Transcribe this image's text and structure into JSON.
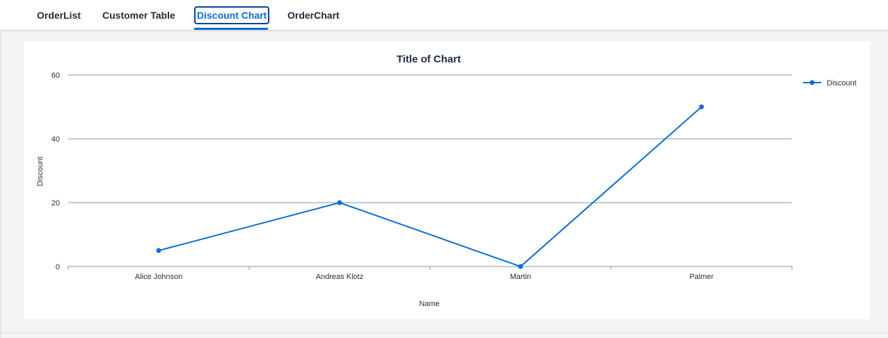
{
  "tabs": [
    {
      "label": "OrderList"
    },
    {
      "label": "Customer Table"
    },
    {
      "label": "Discount Chart"
    },
    {
      "label": "OrderChart"
    }
  ],
  "active_tab": 2,
  "colors": {
    "accent": "#0a6ed1",
    "line": "#0a6ed1",
    "text": "#1d2d3e",
    "grid": "#8396a8"
  },
  "chart_data": {
    "type": "line",
    "title": "Title of Chart",
    "xlabel": "Name",
    "ylabel": "Discount",
    "categories": [
      "Alice Johnson",
      "Andreas Klotz",
      "Martin",
      "Palmer"
    ],
    "series": [
      {
        "name": "Discount",
        "values": [
          5,
          20,
          0,
          50
        ]
      }
    ],
    "ylim": [
      0,
      60
    ],
    "yticks": [
      0,
      20,
      40,
      60
    ],
    "grid": true,
    "legend_position": "top-right"
  }
}
